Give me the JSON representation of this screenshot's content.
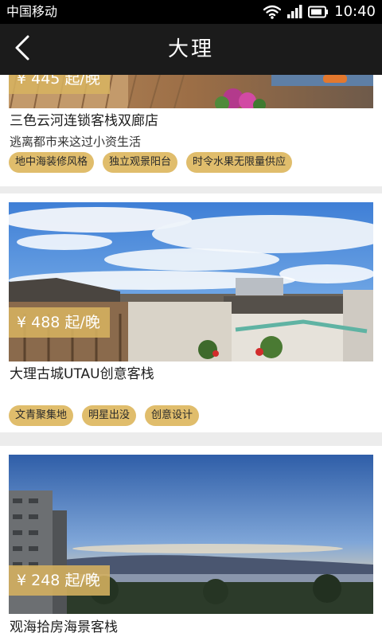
{
  "status_bar": {
    "carrier": "中国移动",
    "time": "10:40",
    "icons": [
      "wifi-icon",
      "signal-icon",
      "battery-icon"
    ]
  },
  "header": {
    "title": "大理",
    "back_icon": "chevron-left-icon"
  },
  "colors": {
    "status_bar": "#000000",
    "header": "#1b1b1b",
    "tag_background": "#e0bd6c",
    "price_badge": "#d6b260",
    "page_background": "#ececec"
  },
  "listings": [
    {
      "price": "¥ 445 起/晚",
      "name": "三色云河连锁客栈双廊店",
      "slogan": "逃离都市来这过小资生活",
      "tags": [
        "地中海装修风格",
        "独立观景阳台",
        "时令水果无限量供应"
      ]
    },
    {
      "price": "¥ 488 起/晚",
      "name": "大理古城UTAU创意客栈",
      "slogan": "",
      "tags": [
        "文青聚集地",
        "明星出没",
        "创意设计"
      ]
    },
    {
      "price": "¥ 248 起/晚",
      "name": "观海拾房海景客栈",
      "slogan": "",
      "tags": []
    }
  ]
}
